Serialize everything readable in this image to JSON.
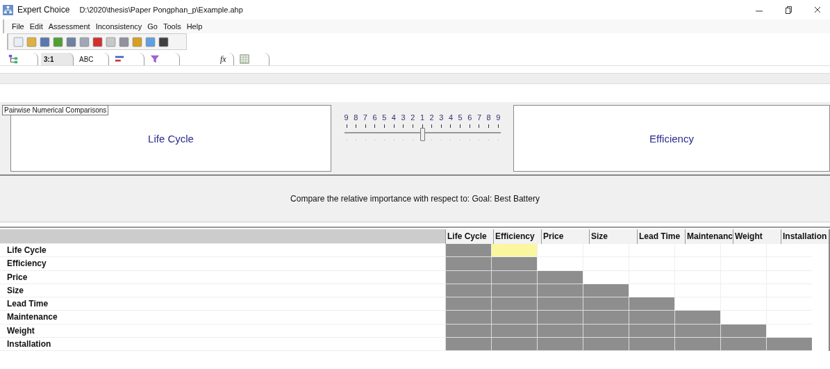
{
  "window": {
    "app": "Expert Choice",
    "path": "D:\\2020\\thesis\\Paper Pongphan_p\\Example.ahp"
  },
  "menu": [
    "File",
    "Edit",
    "Assessment",
    "Inconsistency",
    "Go",
    "Tools",
    "Help"
  ],
  "tabs": [
    {
      "kind": "tree",
      "selected": false
    },
    {
      "kind": "text",
      "text": "3:1",
      "selected": true
    },
    {
      "kind": "text",
      "text": "ABC",
      "selected": false
    },
    {
      "kind": "bars",
      "selected": false
    },
    {
      "kind": "funnel",
      "selected": false
    },
    {
      "kind": "italic",
      "text": "fx",
      "selected": false
    },
    {
      "kind": "grid",
      "selected": false
    }
  ],
  "tooltip": "Pairwise Numerical Comparisons",
  "left_item": "Life Cycle",
  "right_item": "Efficiency",
  "slider": {
    "scale": [
      "9",
      "8",
      "7",
      "6",
      "5",
      "4",
      "3",
      "2",
      "1",
      "2",
      "3",
      "4",
      "5",
      "6",
      "7",
      "8",
      "9"
    ],
    "level": 0.5
  },
  "prompt": "Compare the relative importance with respect to: Goal: Best Battery",
  "table": {
    "columns": [
      "Life Cycle",
      "Efficiency",
      "Price",
      "Size",
      "Lead Time",
      "Maintenanc",
      "Weight",
      "Installation"
    ],
    "rows": [
      {
        "label": "Life Cycle",
        "cells": [
          {
            "shaded": true,
            "selected": false
          },
          {
            "shaded": false,
            "selected": true
          },
          {
            "shaded": false,
            "selected": false
          },
          {
            "shaded": false,
            "selected": false
          },
          {
            "shaded": false,
            "selected": false
          },
          {
            "shaded": false,
            "selected": false
          },
          {
            "shaded": false,
            "selected": false
          },
          {
            "shaded": false,
            "selected": false
          }
        ]
      },
      {
        "label": "Efficiency",
        "cells": [
          {
            "shaded": true,
            "selected": false
          },
          {
            "shaded": true,
            "selected": false
          },
          {
            "shaded": false,
            "selected": false
          },
          {
            "shaded": false,
            "selected": false
          },
          {
            "shaded": false,
            "selected": false
          },
          {
            "shaded": false,
            "selected": false
          },
          {
            "shaded": false,
            "selected": false
          },
          {
            "shaded": false,
            "selected": false
          }
        ]
      },
      {
        "label": "Price",
        "cells": [
          {
            "shaded": true,
            "selected": false
          },
          {
            "shaded": true,
            "selected": false
          },
          {
            "shaded": true,
            "selected": false
          },
          {
            "shaded": false,
            "selected": false
          },
          {
            "shaded": false,
            "selected": false
          },
          {
            "shaded": false,
            "selected": false
          },
          {
            "shaded": false,
            "selected": false
          },
          {
            "shaded": false,
            "selected": false
          }
        ]
      },
      {
        "label": "Size",
        "cells": [
          {
            "shaded": true,
            "selected": false
          },
          {
            "shaded": true,
            "selected": false
          },
          {
            "shaded": true,
            "selected": false
          },
          {
            "shaded": true,
            "selected": false
          },
          {
            "shaded": false,
            "selected": false
          },
          {
            "shaded": false,
            "selected": false
          },
          {
            "shaded": false,
            "selected": false
          },
          {
            "shaded": false,
            "selected": false
          }
        ]
      },
      {
        "label": "Lead Time",
        "cells": [
          {
            "shaded": true,
            "selected": false
          },
          {
            "shaded": true,
            "selected": false
          },
          {
            "shaded": true,
            "selected": false
          },
          {
            "shaded": true,
            "selected": false
          },
          {
            "shaded": true,
            "selected": false
          },
          {
            "shaded": false,
            "selected": false
          },
          {
            "shaded": false,
            "selected": false
          },
          {
            "shaded": false,
            "selected": false
          }
        ]
      },
      {
        "label": "Maintenance",
        "cells": [
          {
            "shaded": true,
            "selected": false
          },
          {
            "shaded": true,
            "selected": false
          },
          {
            "shaded": true,
            "selected": false
          },
          {
            "shaded": true,
            "selected": false
          },
          {
            "shaded": true,
            "selected": false
          },
          {
            "shaded": true,
            "selected": false
          },
          {
            "shaded": false,
            "selected": false
          },
          {
            "shaded": false,
            "selected": false
          }
        ]
      },
      {
        "label": "Weight",
        "cells": [
          {
            "shaded": true,
            "selected": false
          },
          {
            "shaded": true,
            "selected": false
          },
          {
            "shaded": true,
            "selected": false
          },
          {
            "shaded": true,
            "selected": false
          },
          {
            "shaded": true,
            "selected": false
          },
          {
            "shaded": true,
            "selected": false
          },
          {
            "shaded": true,
            "selected": false
          },
          {
            "shaded": false,
            "selected": false
          }
        ]
      },
      {
        "label": "Installation",
        "cells": [
          {
            "shaded": true,
            "selected": false
          },
          {
            "shaded": true,
            "selected": false
          },
          {
            "shaded": true,
            "selected": false
          },
          {
            "shaded": true,
            "selected": false
          },
          {
            "shaded": true,
            "selected": false
          },
          {
            "shaded": true,
            "selected": false
          },
          {
            "shaded": true,
            "selected": false
          },
          {
            "shaded": true,
            "selected": false
          }
        ]
      }
    ]
  }
}
